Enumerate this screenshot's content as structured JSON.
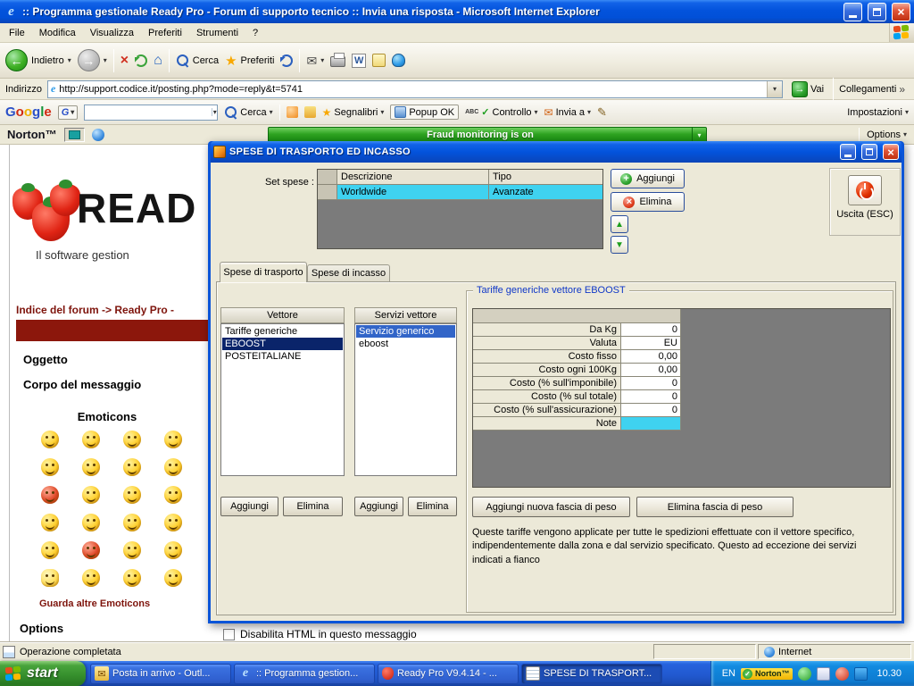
{
  "colors": {
    "titlebar_blue": "#0353DC",
    "selection_navy": "#0A246A",
    "selection_blue": "#3265C8",
    "highlight_cyan": "#3FD2F0",
    "norton_green": "#2FA321",
    "maroon": "#8C170C",
    "taskbar_blue": "#2158CE",
    "start_green": "#37912E"
  },
  "browser": {
    "window_title": ":: Programma gestionale Ready Pro - Forum di supporto tecnico :: Invia una risposta - Microsoft Internet Explorer",
    "menu": [
      "File",
      "Modifica",
      "Visualizza",
      "Preferiti",
      "Strumenti",
      "?"
    ],
    "toolbar": {
      "back": "Indietro",
      "search": "Cerca",
      "favorites": "Preferiti"
    },
    "address": {
      "label": "Indirizzo",
      "url": "http://support.codice.it/posting.php?mode=reply&t=5741",
      "go": "Vai",
      "links": "Collegamenti"
    },
    "google": {
      "logo": "Google",
      "g_button": "G",
      "search": "Cerca",
      "bookmarks": "Segnalibri",
      "popup": "Popup OK",
      "abc": "ABC",
      "spellcheck": "Controllo",
      "send_to": "Invia a",
      "settings": "Impostazioni"
    },
    "norton": {
      "brand": "Norton™",
      "status": "Fraud monitoring is on",
      "options": "Options"
    },
    "status": {
      "message": "Operazione completata",
      "zone": "Internet"
    }
  },
  "page": {
    "logo": "READ",
    "tagline": "Il software gestion",
    "breadcrumb": "Indice del forum -> Ready Pro -",
    "subject": "Oggetto",
    "body_label": "Corpo del messaggio",
    "emoticons_title": "Emoticons",
    "more_emoticons": "Guarda altre Emoticons",
    "options": "Options",
    "disable_html": "Disabilita HTML in questo messaggio"
  },
  "dialog": {
    "title": "SPESE DI TRASPORTO ED INCASSO",
    "set_label": "Set spese :",
    "set_table": {
      "col_desc": "Descrizione",
      "col_tipo": "Tipo",
      "row_desc": "Worldwide",
      "row_tipo": "Avanzate"
    },
    "btn_add": "Aggiungi",
    "btn_delete": "Elimina",
    "btn_exit": "Uscita (ESC)",
    "tab1": "Spese di trasporto",
    "tab2": "Spese di incasso",
    "vettore": {
      "header": "Vettore",
      "items": [
        "Tariffe generiche",
        "EBOOST",
        "POSTEITALIANE"
      ],
      "btn_add": "Aggiungi",
      "btn_delete": "Elimina"
    },
    "servizi": {
      "header": "Servizi vettore",
      "items": [
        "Servizio generico",
        "eboost"
      ],
      "btn_add": "Aggiungi",
      "btn_delete": "Elimina"
    },
    "tariffe": {
      "title": "Tariffe generiche vettore EBOOST",
      "rows": [
        {
          "label": "Da Kg",
          "value": "0"
        },
        {
          "label": "Valuta",
          "value": "EU"
        },
        {
          "label": "Costo fisso",
          "value": "0,00"
        },
        {
          "label": "Costo ogni 100Kg",
          "value": "0,00"
        },
        {
          "label": "Costo (% sull'imponibile)",
          "value": "0"
        },
        {
          "label": "Costo (% sul totale)",
          "value": "0"
        },
        {
          "label": "Costo (% sull'assicurazione)",
          "value": "0"
        },
        {
          "label": "Note",
          "value": ""
        }
      ],
      "btn_add_weight": "Aggiungi nuova fascia di peso",
      "btn_del_weight": "Elimina fascia di peso",
      "note": "Queste tariffe vengono applicate per tutte le spedizioni effettuate con il vettore specifico, indipendentemente dalla zona e dal servizio specificato. Questo ad eccezione dei servizi indicati a fianco"
    }
  },
  "taskbar": {
    "start": "start",
    "tasks": [
      {
        "label": "Posta in arrivo - Outl..."
      },
      {
        "label": ":: Programma gestion..."
      },
      {
        "label": "Ready Pro V9.4.14 - ..."
      },
      {
        "label": "SPESE DI TRASPORT..."
      }
    ],
    "tray": {
      "lang": "EN",
      "norton": "Norton™",
      "clock": "10.30"
    }
  }
}
